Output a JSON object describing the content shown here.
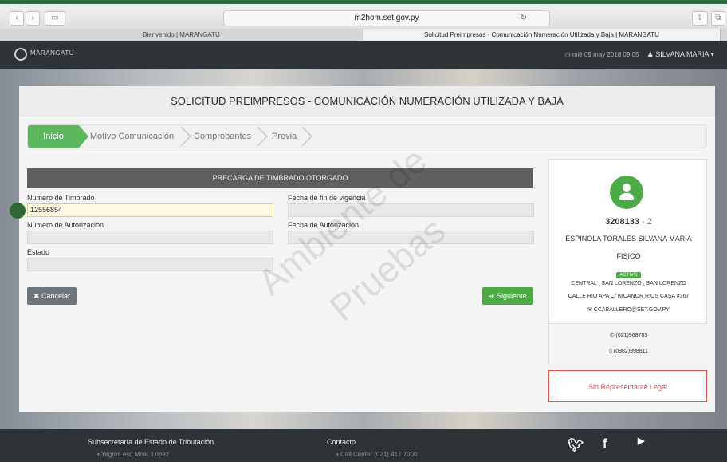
{
  "browser": {
    "url": "m2hom.set.gov.py",
    "tabs": [
      {
        "title": "Bienvenido | MARANGATU"
      },
      {
        "title": "Solicitud Preimpresos - Comunicación Numeración Utilizada y Baja | MARANGATU"
      }
    ]
  },
  "navbar": {
    "brand": "MARANGATU",
    "datetime": "mié 09 may 2018 09:05",
    "user": "SILVANA MARIA"
  },
  "panel": {
    "title": "SOLICITUD PREIMPRESOS - COMUNICACIÓN NUMERACIÓN UTILIZADA Y BAJA",
    "steps": [
      {
        "label": "Inicio"
      },
      {
        "label": "Motivo Comunicación"
      },
      {
        "label": "Comprobantes"
      },
      {
        "label": "Previa"
      }
    ]
  },
  "form": {
    "header": "PRECARGA DE TIMBRADO OTORGADO",
    "numero_timbrado_label": "Número de Timbrado",
    "numero_timbrado_value": "12556854",
    "fecha_fin_label": "Fecha de fin de vigencia",
    "fecha_fin_value": "",
    "numero_autorizacion_label": "Número de Autorización",
    "numero_autorizacion_value": "",
    "fecha_autorizacion_label": "Fecha de Autorización",
    "fecha_autorizacion_value": "",
    "estado_label": "Estado",
    "estado_value": "",
    "cancel_label": "✖ Cancelar",
    "next_label": "➔ Siguiente"
  },
  "profile": {
    "ruc": "3208133",
    "dv": "- 2",
    "name": "ESPINOLA TORALES SILVANA MARIA",
    "type": "FISICO",
    "status": "ACTIVO",
    "location": "CENTRAL , SAN LORENZO , SAN LORENZO",
    "address": "CALLE RIO APA C/ NICANOR RIOS CASA #367",
    "email": "✉ CCABALLERO@SET.GOV.PY",
    "phone": "✆ (021)968703",
    "mobile": "▯ (0982)998811",
    "legal": "Sin Representante Legal"
  },
  "watermark": {
    "line1": "Ambiente de",
    "line2": "Pruebas"
  },
  "footer": {
    "org": "Subsecretaría de Estado de Tributación",
    "address": "• Yegros esq Mcal. Lopez",
    "contact": "Contacto",
    "call_center": "• Call Center (021) 417 7000"
  },
  "colors": {
    "accent": "#4caa47",
    "navbar": "#2e3338",
    "danger": "#d9534f"
  }
}
